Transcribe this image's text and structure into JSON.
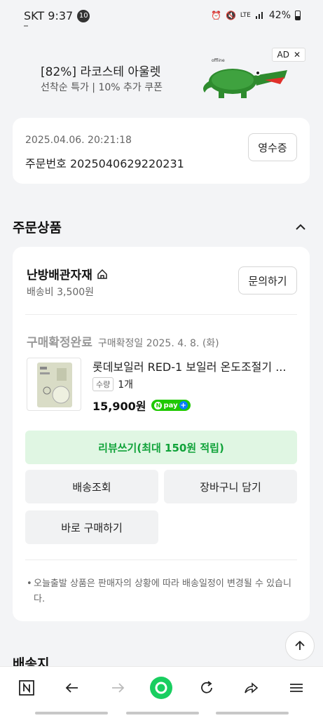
{
  "status_bar": {
    "carrier_time": "SKT 9:37",
    "notification_count": "10",
    "signal_label": "LTE",
    "battery": "42%"
  },
  "ad": {
    "title": "[82%] 라코스테 아울렛",
    "subtitle": "선착순 특가  |  10% 추가 쿠폰",
    "badge": "AD",
    "close": "✕",
    "brand_mark": "offline"
  },
  "order": {
    "datetime": "2025.04.06. 20:21:18",
    "order_number": "주문번호 2025040629220231",
    "receipt_label": "영수증"
  },
  "section": {
    "title": "주문상품"
  },
  "seller": {
    "name": "난방배관자재",
    "shipping_fee": "배송비 3,500원",
    "inquiry_label": "문의하기"
  },
  "item": {
    "status": "구매확정완료",
    "confirm_date": "구매확정일 2025. 4. 8. (화)",
    "name": "롯데보일러 RED-1 보일러 온도조절기 ...",
    "qty_tag": "수량",
    "qty": "1개",
    "price": "15,900원",
    "npay_label": "pay"
  },
  "actions": {
    "review": "리뷰쓰기(최대 150원 적립)",
    "track": "배송조회",
    "cart": "장바구니 담기",
    "buy_now": "바로 구매하기"
  },
  "notice": "오늘출발 상품은 판매자의 상황에 따라 배송일정이 변경될 수 있습니다.",
  "next_section": "배송지",
  "colors": {
    "green": "#11a33a",
    "review_bg": "#e0f6e3",
    "npay": "#1ec800",
    "page_bg": "#f3f4f6"
  }
}
